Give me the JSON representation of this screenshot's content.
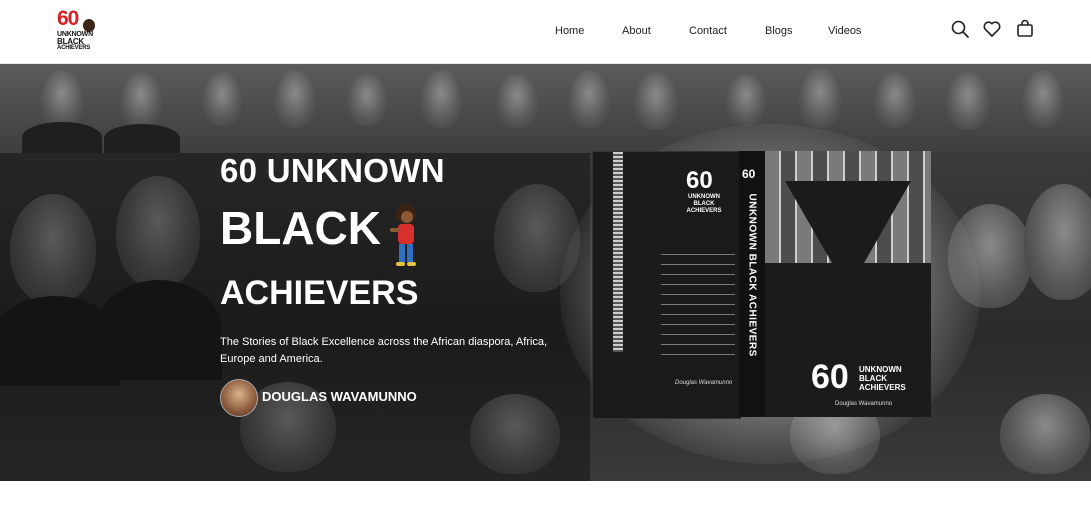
{
  "brand": {
    "logo_number": "60",
    "logo_line1": "UNKNOWN",
    "logo_line2": "BLACK",
    "logo_line3": "ACHIEVERS"
  },
  "nav": {
    "items": [
      {
        "label": "Home"
      },
      {
        "label": "About"
      },
      {
        "label": "Contact"
      },
      {
        "label": "Blogs"
      },
      {
        "label": "Videos"
      }
    ]
  },
  "header_icons": [
    "search-icon",
    "heart-icon",
    "shopping-bag-icon"
  ],
  "hero": {
    "title_line1": "60 UNKNOWN",
    "title_line2": "BLACK",
    "title_line3": "ACHIEVERS",
    "description": "The Stories of Black Excellence across the African diaspora, Africa, Europe and America.",
    "author_name": "DOUGLAS WAVAMUNNO"
  },
  "book": {
    "back_number": "60",
    "back_title": "UNKNOWN BLACK ACHIEVERS",
    "back_author": "Douglas Wavamunno",
    "spine_number": "60",
    "spine_title": "UNKNOWN BLACK ACHIEVERS",
    "front_number": "60",
    "front_title_line1": "UNKNOWN",
    "front_title_line2": "BLACK",
    "front_title_line3": "ACHIEVERS",
    "front_author": "Douglas Wavamunno"
  },
  "colors": {
    "brand_red": "#d62027",
    "hero_dark": "#2c2c2c",
    "text_white": "#ffffff"
  }
}
